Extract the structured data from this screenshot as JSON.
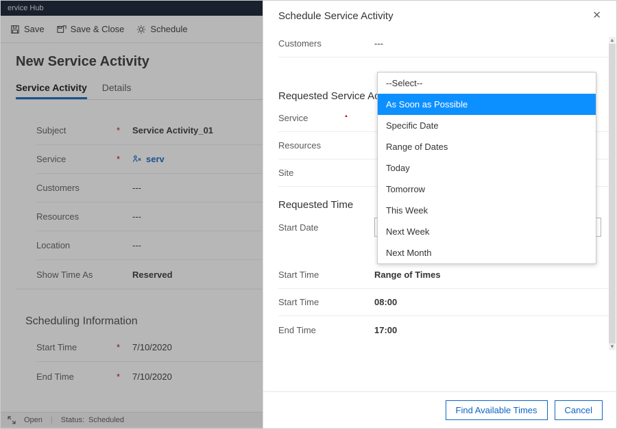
{
  "app": {
    "name": "ervice Hub"
  },
  "commands": {
    "save": "Save",
    "saveClose": "Save & Close",
    "schedule": "Schedule"
  },
  "page": {
    "title": "New Service Activity",
    "tabs": {
      "activity": "Service Activity",
      "details": "Details"
    }
  },
  "form": {
    "subject": {
      "label": "Subject",
      "value": "Service Activity_01"
    },
    "service": {
      "label": "Service",
      "value": "serv"
    },
    "customers": {
      "label": "Customers",
      "value": "---"
    },
    "resources": {
      "label": "Resources",
      "value": "---"
    },
    "location": {
      "label": "Location",
      "value": "---"
    },
    "showTimeAs": {
      "label": "Show Time As",
      "value": "Reserved"
    }
  },
  "schedulingSection": {
    "title": "Scheduling Information",
    "startTime": {
      "label": "Start Time",
      "value": "7/10/2020"
    },
    "endTime": {
      "label": "End Time",
      "value": "7/10/2020"
    }
  },
  "status": {
    "open": "Open",
    "statusLabel": "Status:",
    "statusValue": "Scheduled"
  },
  "panel": {
    "title": "Schedule Service Activity",
    "customers": {
      "label": "Customers",
      "value": "---"
    },
    "requestedSection": "Requested Service Activit",
    "service": {
      "label": "Service"
    },
    "resources": {
      "label": "Resources"
    },
    "site": {
      "label": "Site"
    },
    "requestedTimeSection": "Requested Time",
    "startDate": {
      "label": "Start Date",
      "value": "As Soon as Possible"
    },
    "startTimeRange": {
      "label": "Start Time",
      "value": "Range of Times"
    },
    "startTime": {
      "label": "Start Time",
      "value": "08:00"
    },
    "endTime": {
      "label": "End Time",
      "value": "17:00"
    },
    "findBtn": "Find Available Times",
    "cancelBtn": "Cancel"
  },
  "dropdown": {
    "placeholder": "--Select--",
    "options": [
      "As Soon as Possible",
      "Specific Date",
      "Range of Dates",
      "Today",
      "Tomorrow",
      "This Week",
      "Next Week",
      "Next Month"
    ],
    "selectedIndex": 0
  }
}
